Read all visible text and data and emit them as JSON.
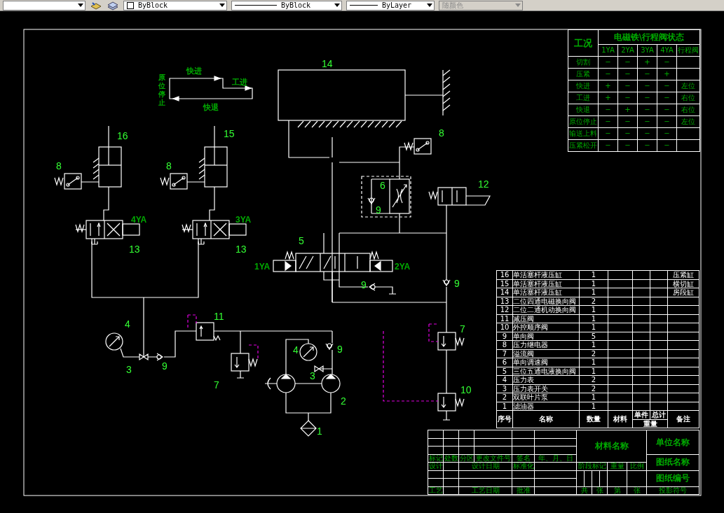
{
  "toolbar": {
    "dropdowns": [
      {
        "kind": "color",
        "text": "ByBlock",
        "disabled": false
      },
      {
        "kind": "linetype",
        "text": "ByBlock",
        "disabled": false
      },
      {
        "kind": "lineweight",
        "text": "ByLayer",
        "disabled": false
      },
      {
        "kind": "plotstyle",
        "text": "随颜色",
        "disabled": true
      }
    ]
  },
  "motion_diagram": {
    "labels": [
      "快进",
      "工进",
      "快退"
    ],
    "vertical_label": "原位停止"
  },
  "callouts": [
    "14",
    "16",
    "15",
    "8",
    "8",
    "8",
    "6",
    "9",
    "12",
    "5",
    "13",
    "13",
    "9",
    "9",
    "4",
    "11",
    "7",
    "9",
    "3",
    "9",
    "4",
    "3",
    "2",
    "7",
    "10",
    "1"
  ],
  "solenoid_labels": [
    "4YA",
    "3YA",
    "1YA",
    "2YA"
  ],
  "state_table": {
    "corner": "工况",
    "title": "电磁铁\\行程阀状态",
    "columns": [
      "1YA",
      "2YA",
      "3YA",
      "4YA",
      "行程阀"
    ],
    "rows": [
      {
        "label": "切割",
        "cells": [
          "−",
          "−",
          "+",
          "−",
          ""
        ]
      },
      {
        "label": "压紧",
        "cells": [
          "−",
          "−",
          "−",
          "+",
          ""
        ]
      },
      {
        "label": "快进",
        "cells": [
          "+",
          "−",
          "−",
          "−",
          "左位"
        ]
      },
      {
        "label": "工进",
        "cells": [
          "+",
          "−",
          "−",
          "−",
          "右位"
        ]
      },
      {
        "label": "快退",
        "cells": [
          "−",
          "+",
          "−",
          "−",
          "右位"
        ]
      },
      {
        "label": "原位停止",
        "cells": [
          "−",
          "−",
          "−",
          "−",
          "左位"
        ]
      },
      {
        "label": "输送上料",
        "cells": [
          "−",
          "−",
          "−",
          "−",
          ""
        ]
      },
      {
        "label": "压紧松开",
        "cells": [
          "−",
          "−",
          "−",
          "−",
          ""
        ]
      }
    ]
  },
  "parts_list": {
    "header": {
      "no": "序号",
      "name": "名称",
      "qty": "数量",
      "material": "材料",
      "unit": "单件",
      "total": "总计",
      "weight": "重量",
      "note": "备注"
    },
    "rows": [
      {
        "no": "16",
        "name": "单活塞杆液压缸",
        "qty": "1",
        "note": "压紧缸"
      },
      {
        "no": "15",
        "name": "单活塞杆液压缸",
        "qty": "1",
        "note": "横切缸"
      },
      {
        "no": "14",
        "name": "单活塞杆液压缸",
        "qty": "1",
        "note": "房段缸"
      },
      {
        "no": "13",
        "name": "二位四通电磁换向阀",
        "qty": "2"
      },
      {
        "no": "12",
        "name": "二位二通机动换向阀",
        "qty": "1"
      },
      {
        "no": "11",
        "name": "减压阀",
        "qty": "1"
      },
      {
        "no": "10",
        "name": "外控顺序阀",
        "qty": "1"
      },
      {
        "no": "9",
        "name": "单向阀",
        "qty": "5"
      },
      {
        "no": "8",
        "name": "压力继电器",
        "qty": "1"
      },
      {
        "no": "7",
        "name": "溢流阀",
        "qty": "2"
      },
      {
        "no": "6",
        "name": "单向调速阀",
        "qty": "1"
      },
      {
        "no": "5",
        "name": "三位五通电液换向阀",
        "qty": "1"
      },
      {
        "no": "4",
        "name": "压力表",
        "qty": "2"
      },
      {
        "no": "3",
        "name": "压力表开关",
        "qty": "2"
      },
      {
        "no": "2",
        "name": "双联叶片泵",
        "qty": "1"
      },
      {
        "no": "1",
        "name": "滤油器",
        "qty": "1"
      }
    ]
  },
  "title_block": {
    "revision_headers": [
      "标记",
      "处数",
      "分区",
      "更改文件号",
      "签名",
      "年、月、日"
    ],
    "design_row": [
      "设计",
      "设计日期",
      "标准化"
    ],
    "process_row": [
      "工艺",
      "工艺日期",
      "批准"
    ],
    "material_name": "材料名称",
    "stage_headers": [
      "阶段标记",
      "重量",
      "比例"
    ],
    "sheet_row": [
      "共",
      "张",
      "第",
      "张"
    ],
    "right_column": [
      "单位名称",
      "图纸名称",
      "图纸编号",
      "投影符号"
    ]
  }
}
